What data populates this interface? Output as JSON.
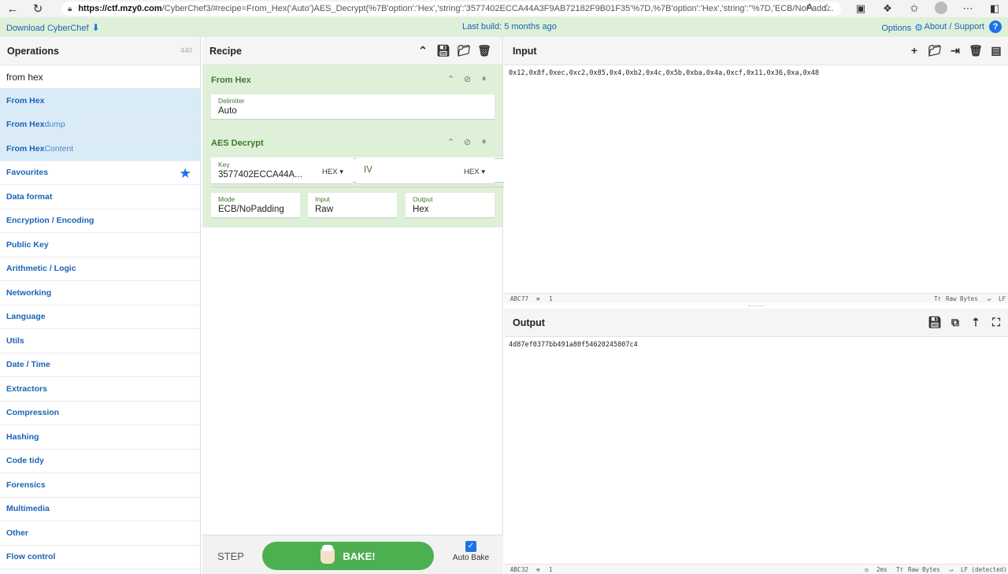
{
  "browser": {
    "url_host": "https://ctf.mzy0.com",
    "url_rest": "/CyberChef3/#recipe=From_Hex('Auto')AES_Decrypt(%7B'option':'Hex','string':'3577402ECCA44A3F9AB72182F9B01F35'%7D,%7B'option':'Hex','string':''%7D,'ECB/NoPadd..."
  },
  "banner": {
    "download": "Download CyberChef",
    "last_build": "Last build: 5 months ago",
    "options": "Options",
    "about": "About / Support"
  },
  "operations": {
    "title": "Operations",
    "count": "440",
    "search_value": "from hex",
    "results": [
      {
        "prefix": "From Hex",
        "suffix": ""
      },
      {
        "prefix": "From Hex",
        "suffix": "dump"
      },
      {
        "prefix": "From Hex",
        "suffix": " Content"
      }
    ],
    "categories": [
      "Favourites",
      "Data format",
      "Encryption / Encoding",
      "Public Key",
      "Arithmetic / Logic",
      "Networking",
      "Language",
      "Utils",
      "Date / Time",
      "Extractors",
      "Compression",
      "Hashing",
      "Code tidy",
      "Forensics",
      "Multimedia",
      "Other",
      "Flow control"
    ]
  },
  "recipe": {
    "title": "Recipe",
    "from_hex": {
      "title": "From Hex",
      "delimiter_label": "Delimiter",
      "delimiter_value": "Auto"
    },
    "aes": {
      "title": "AES Decrypt",
      "key_label": "Key",
      "key_value": "3577402ECCA44A...",
      "key_format": "HEX",
      "iv_placeholder": "IV",
      "iv_format": "HEX",
      "mode_label": "Mode",
      "mode_value": "ECB/NoPadding",
      "input_label": "Input",
      "input_value": "Raw",
      "output_label": "Output",
      "output_value": "Hex"
    },
    "step": "STEP",
    "bake": "BAKE!",
    "auto_bake": "Auto Bake"
  },
  "input": {
    "title": "Input",
    "text": "0x12,0x8f,0xec,0xc2,0x85,0x4,0xb2,0x4c,0x5b,0xba,0x4a,0xcf,0x11,0x36,0xa,0x48",
    "length": "77",
    "lines": "1",
    "format": "Raw Bytes",
    "eol": "LF"
  },
  "output": {
    "title": "Output",
    "text": "4d87ef0377bb491a80f54620245807c4",
    "length": "32",
    "lines": "1",
    "time": "2ms",
    "format": "Raw Bytes",
    "eol": "LF (detected)"
  }
}
